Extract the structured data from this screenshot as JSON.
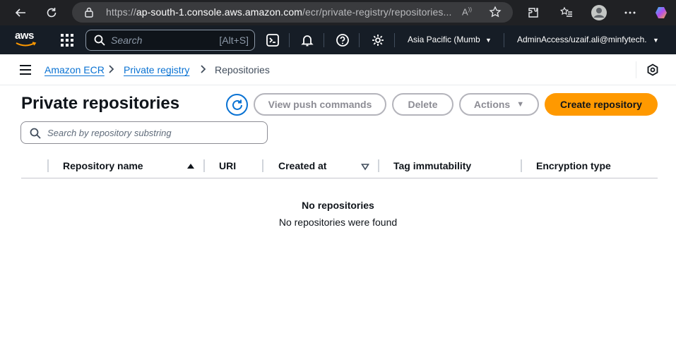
{
  "browser": {
    "url_prefix": "https://",
    "url_host": "ap-south-1.console.aws.amazon.com",
    "url_path": "/ecr/private-registry/repositories..."
  },
  "aws_nav": {
    "logo_text": "aws",
    "search_placeholder": "Search",
    "search_shortcut": "[Alt+S]",
    "region": "Asia Pacific (Mumb",
    "account": "AdminAccess/uzaif.ali@minfytech."
  },
  "breadcrumb": {
    "items": [
      {
        "label": "Amazon ECR"
      },
      {
        "label": "Private registry"
      },
      {
        "label": "Repositories"
      }
    ]
  },
  "header": {
    "title": "Private repositories",
    "view_push_label": "View push commands",
    "delete_label": "Delete",
    "actions_label": "Actions",
    "create_label": "Create repository"
  },
  "filter": {
    "placeholder": "Search by repository substring"
  },
  "table": {
    "columns": [
      "Repository name",
      "URI",
      "Created at",
      "Tag immutability",
      "Encryption type"
    ],
    "empty_title": "No repositories",
    "empty_message": "No repositories were found"
  },
  "colors": {
    "primary_button": "#ff9900",
    "link": "#0972d3",
    "nav_bg": "#161d26"
  }
}
